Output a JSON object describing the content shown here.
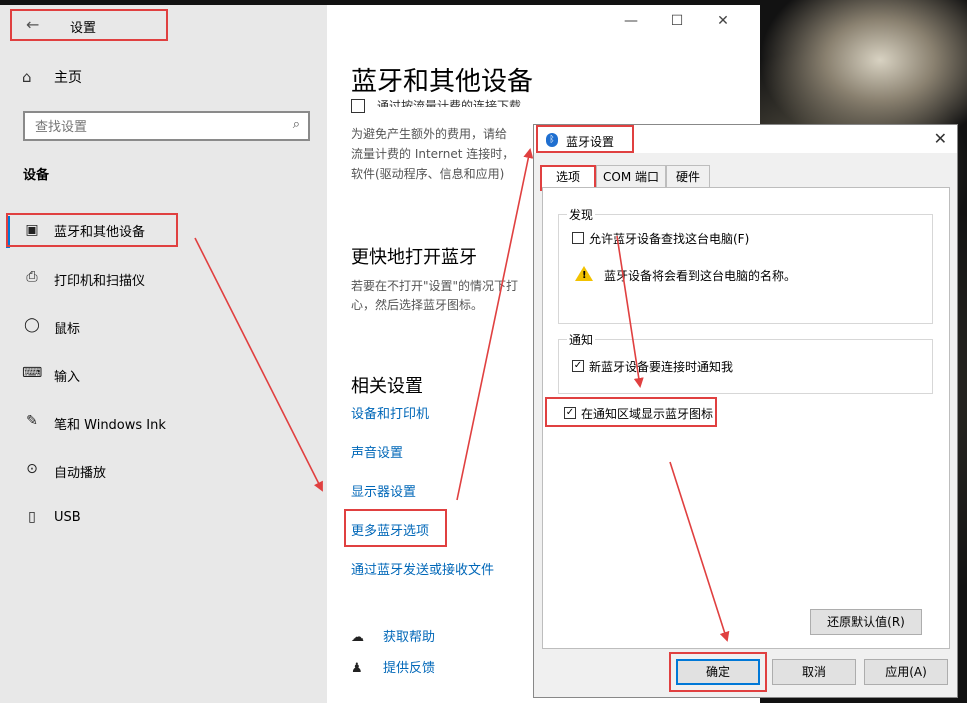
{
  "settings": {
    "title": "设置",
    "home": "主页",
    "search_placeholder": "查找设置",
    "section": "设备",
    "nav": [
      {
        "label": "蓝牙和其他设备",
        "icon": "bluetooth-devices-icon"
      },
      {
        "label": "打印机和扫描仪",
        "icon": "printer-icon"
      },
      {
        "label": "鼠标",
        "icon": "mouse-icon"
      },
      {
        "label": "输入",
        "icon": "keyboard-icon"
      },
      {
        "label": "笔和 Windows Ink",
        "icon": "pen-icon"
      },
      {
        "label": "自动播放",
        "icon": "autoplay-icon"
      },
      {
        "label": "USB",
        "icon": "usb-icon"
      }
    ],
    "window_controls": {
      "minimize": "—",
      "maximize": "☐",
      "close": "✕"
    }
  },
  "content": {
    "page_title": "蓝牙和其他设备",
    "metered_checkbox": "通过按流量计费的连接下载",
    "metered_desc": [
      "为避免产生额外的费用，请给",
      "流量计费的 Internet 连接时，",
      "软件(驱动程序、信息和应用)"
    ],
    "quick_title": "更快地打开蓝牙",
    "quick_desc": [
      "若要在不打开\"设置\"的情况下打",
      "心，然后选择蓝牙图标。"
    ],
    "related_title": "相关设置",
    "links": [
      "设备和打印机",
      "声音设置",
      "显示器设置",
      "更多蓝牙选项",
      "通过蓝牙发送或接收文件"
    ],
    "help": [
      {
        "label": "获取帮助",
        "icon": "help-chat-icon"
      },
      {
        "label": "提供反馈",
        "icon": "feedback-icon"
      }
    ]
  },
  "bt_dialog": {
    "title": "蓝牙设置",
    "tabs": [
      "选项",
      "COM 端口",
      "硬件"
    ],
    "discovery_legend": "发现",
    "allow_discovery": "允许蓝牙设备查找这台电脑(F)",
    "allow_discovery_checked": false,
    "warning": "蓝牙设备将会看到这台电脑的名称。",
    "notify_legend": "通知",
    "notify_connect": "新蓝牙设备要连接时通知我",
    "notify_connect_checked": true,
    "show_tray_icon": "在通知区域显示蓝牙图标",
    "show_tray_icon_checked": true,
    "restore_defaults": "还原默认值(R)",
    "ok": "确定",
    "cancel": "取消",
    "apply": "应用(A)"
  },
  "colors": {
    "highlight": "#e04040",
    "link": "#0067b8",
    "accent": "#0078d7"
  }
}
